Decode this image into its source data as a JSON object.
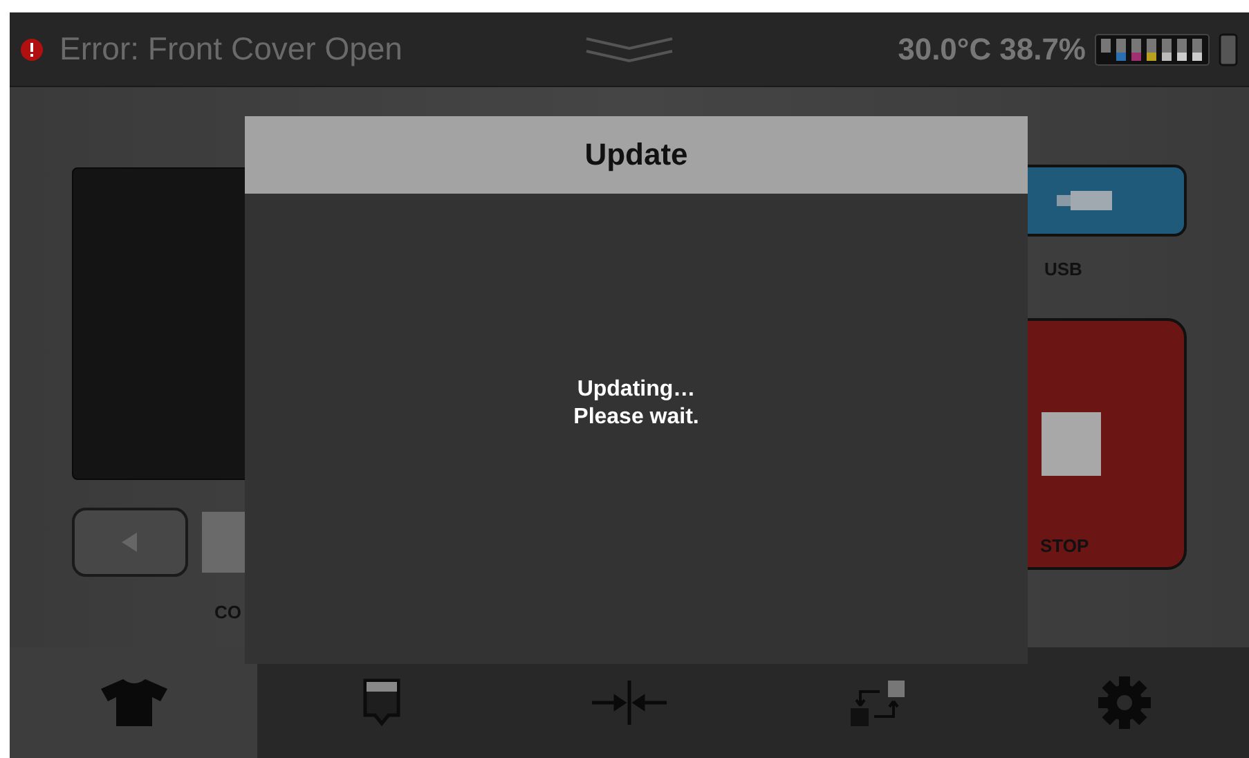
{
  "status_bar": {
    "error": "Error: Front Cover Open",
    "temperature": "30.0°C",
    "humidity": "38.7%"
  },
  "left_panel": {
    "label": "CO"
  },
  "right_panel": {
    "usb_label": "USB",
    "stop_label": "STOP"
  },
  "dialog": {
    "title": "Update",
    "message_lines": [
      "Updating…",
      "Please wait."
    ]
  },
  "nav": [
    {
      "kind": "shirt",
      "selected": true
    },
    {
      "kind": "tray",
      "selected": false
    },
    {
      "kind": "align",
      "selected": false
    },
    {
      "kind": "swap",
      "selected": false
    },
    {
      "kind": "settings",
      "selected": false
    }
  ]
}
